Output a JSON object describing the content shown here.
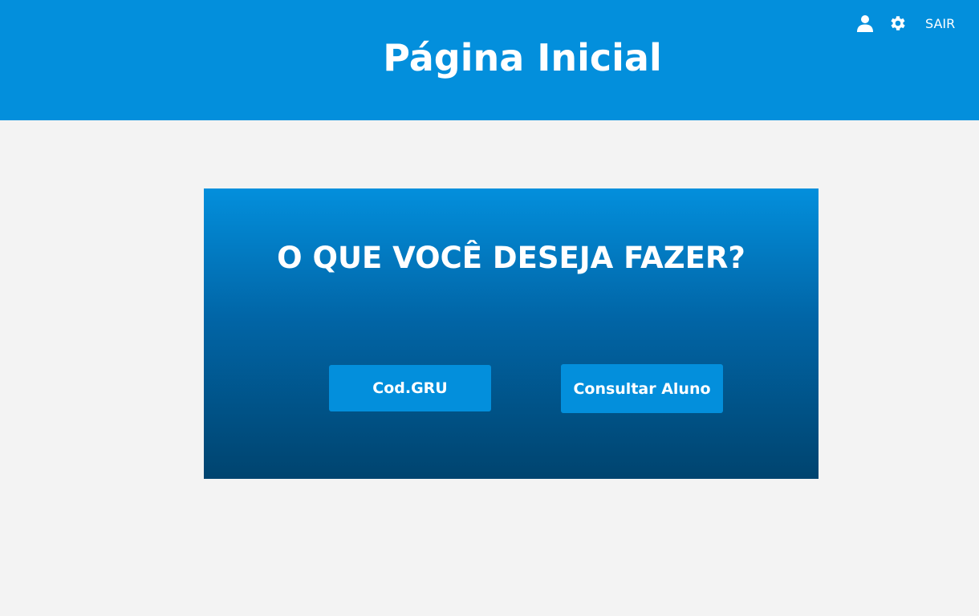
{
  "header": {
    "title": "Página Inicial",
    "logout_label": "SAIR",
    "icons": [
      "user-icon",
      "gear-icon"
    ]
  },
  "panel": {
    "heading": "O QUE VOCÊ DESEJA FAZER?",
    "buttons": [
      {
        "label": "Cod.GRU"
      },
      {
        "label": "Consultar Aluno"
      }
    ]
  },
  "colors": {
    "primary": "#038fdc",
    "gradient_end": "#00446f",
    "background": "#f3f3f3",
    "text": "#ffffff"
  }
}
